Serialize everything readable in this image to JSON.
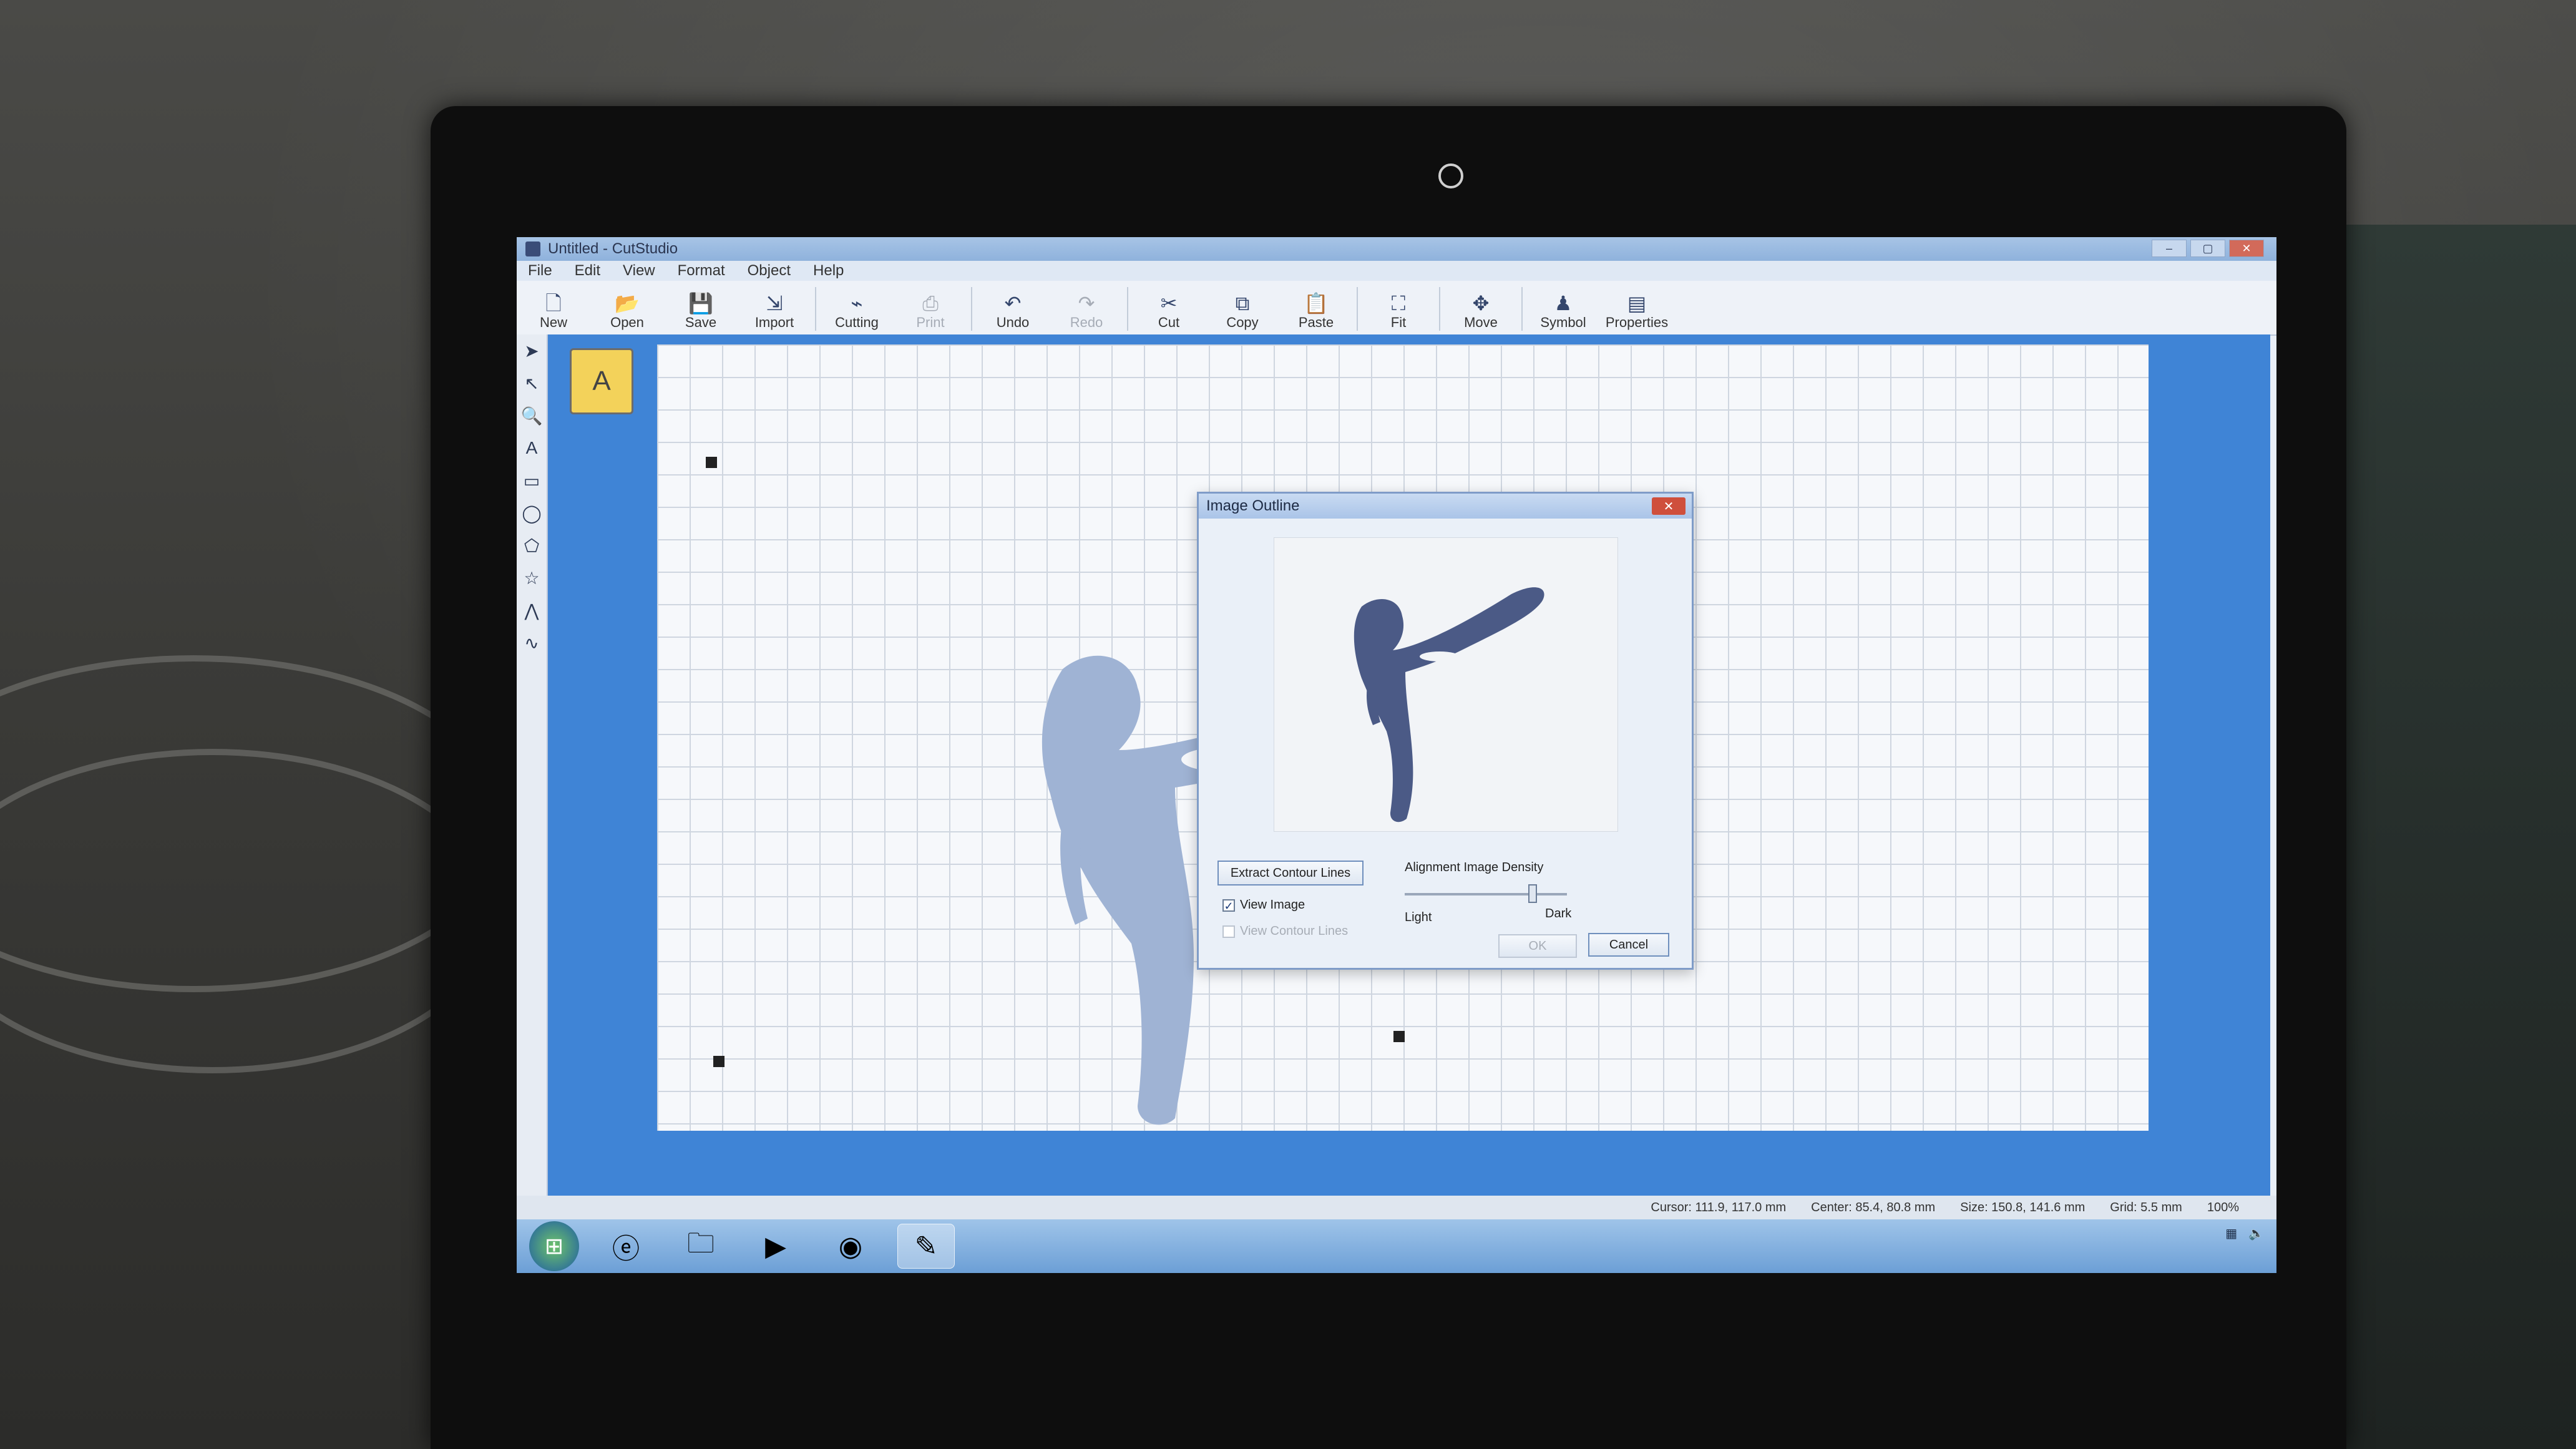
{
  "window": {
    "title": "Untitled - CutStudio",
    "controls": [
      "–",
      "▢",
      "✕"
    ]
  },
  "menu": [
    "File",
    "Edit",
    "View",
    "Format",
    "Object",
    "Help"
  ],
  "toolbar": [
    {
      "label": "New",
      "icon": "new-icon",
      "glyph": "🗋",
      "disabled": false
    },
    {
      "label": "Open",
      "icon": "open-icon",
      "glyph": "📂",
      "disabled": false
    },
    {
      "label": "Save",
      "icon": "save-icon",
      "glyph": "💾",
      "disabled": false
    },
    {
      "label": "Import",
      "icon": "import-icon",
      "glyph": "⇲",
      "disabled": false
    },
    {
      "sep": true
    },
    {
      "label": "Cutting",
      "icon": "cutting-icon",
      "glyph": "⌁",
      "disabled": false
    },
    {
      "label": "Print",
      "icon": "print-icon",
      "glyph": "⎙",
      "disabled": true
    },
    {
      "sep": true
    },
    {
      "label": "Undo",
      "icon": "undo-icon",
      "glyph": "↶",
      "disabled": false
    },
    {
      "label": "Redo",
      "icon": "redo-icon",
      "glyph": "↷",
      "disabled": true
    },
    {
      "sep": true
    },
    {
      "label": "Cut",
      "icon": "cut-icon",
      "glyph": "✂",
      "disabled": false
    },
    {
      "label": "Copy",
      "icon": "copy-icon",
      "glyph": "⧉",
      "disabled": false
    },
    {
      "label": "Paste",
      "icon": "paste-icon",
      "glyph": "📋",
      "disabled": false
    },
    {
      "sep": true
    },
    {
      "label": "Fit",
      "icon": "fit-icon",
      "glyph": "⛶",
      "disabled": false
    },
    {
      "sep": true
    },
    {
      "label": "Move",
      "icon": "move-icon",
      "glyph": "✥",
      "disabled": false
    },
    {
      "sep": true
    },
    {
      "label": "Symbol",
      "icon": "symbol-icon",
      "glyph": "♟",
      "disabled": false
    },
    {
      "label": "Properties",
      "icon": "properties-icon",
      "glyph": "▤",
      "disabled": false
    }
  ],
  "tools": [
    {
      "name": "select-arrow-icon",
      "glyph": "➤"
    },
    {
      "name": "node-edit-icon",
      "glyph": "↖"
    },
    {
      "name": "zoom-icon",
      "glyph": "🔍"
    },
    {
      "name": "text-icon",
      "glyph": "A"
    },
    {
      "name": "rectangle-icon",
      "glyph": "▭"
    },
    {
      "name": "ellipse-icon",
      "glyph": "◯"
    },
    {
      "name": "polygon-icon",
      "glyph": "⬠"
    },
    {
      "name": "star-icon",
      "glyph": "☆"
    },
    {
      "name": "polyline-icon",
      "glyph": "⋀"
    },
    {
      "name": "curve-icon",
      "glyph": "∿"
    }
  ],
  "dialog": {
    "title": "Image Outline",
    "close": "✕",
    "extract_button": "Extract Contour Lines",
    "view_image": {
      "label": "View Image",
      "checked": true
    },
    "view_contour": {
      "label": "View Contour Lines",
      "checked": false
    },
    "density_label": "Alignment Image Density",
    "light": "Light",
    "dark": "Dark",
    "ok": "OK",
    "cancel": "Cancel"
  },
  "status": {
    "cursor": "Cursor: 111.9, 117.0 mm",
    "center": "Center: 85.4, 80.8 mm",
    "size": "Size: 150.8, 141.6 mm",
    "grid": "Grid: 5.5 mm",
    "zoom": "100%"
  },
  "taskbar": [
    {
      "name": "start-button-icon",
      "glyph": "⊞"
    },
    {
      "name": "internet-explorer-icon",
      "glyph": "ⓔ"
    },
    {
      "name": "file-explorer-icon",
      "glyph": "🗀"
    },
    {
      "name": "media-player-icon",
      "glyph": "▶"
    },
    {
      "name": "chrome-icon",
      "glyph": "◉"
    },
    {
      "name": "cutstudio-taskbar-icon",
      "glyph": "✎"
    }
  ]
}
